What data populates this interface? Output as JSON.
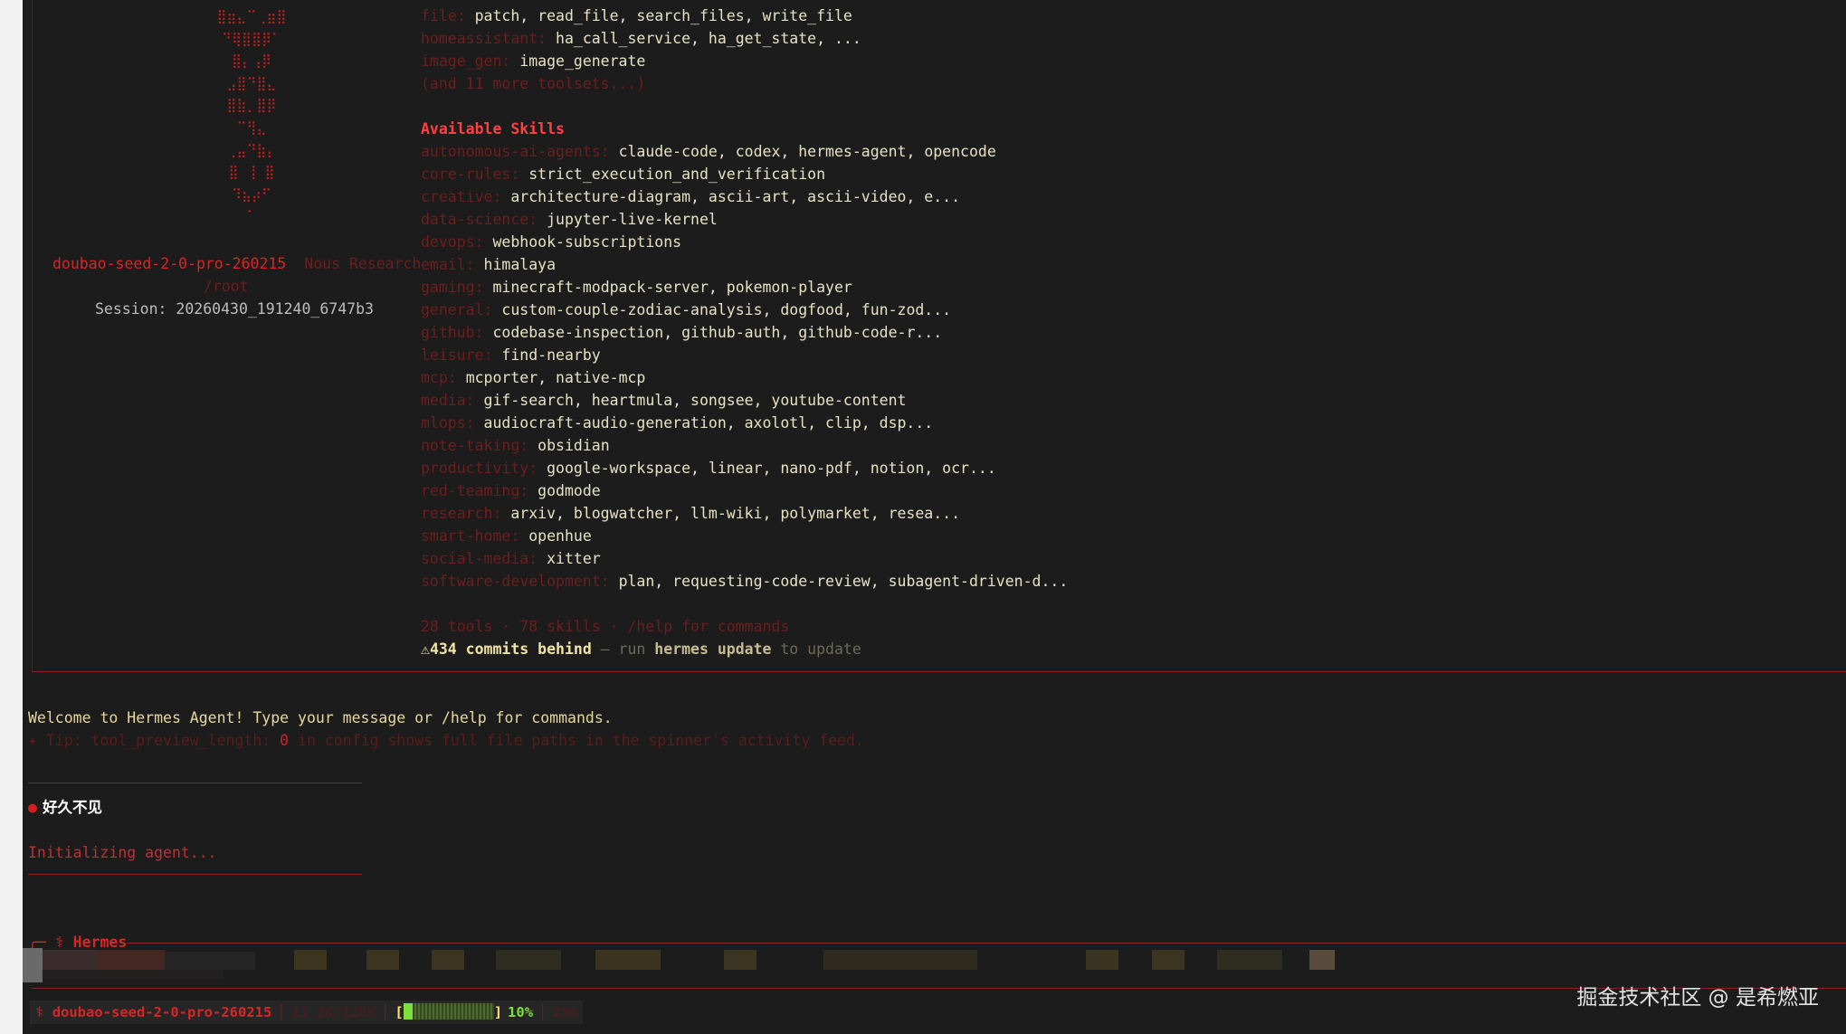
{
  "banner": {
    "art_lines": [
      "⣿⣶⣄⠉⢀⣶⣿",
      "⠙⢿⣿⣿⡿⠁",
      "⣿⡄⢠⡿",
      "⣠⣿⠙⣿⣄",
      "⣿⣷⡀⣿⡿",
      "⠉⢻⣄",
      "⢀⣤⠙⣷⡄",
      "⣿ ⢸ ⣿",
      "⠹⣦⡴⠋",
      "⠁"
    ],
    "model": "doubao-seed-2-0-pro-260215",
    "org": "Nous Research",
    "cwd": "/root",
    "session": "Session: 20260430_191240_6747b3"
  },
  "toolsets": [
    {
      "name": "file:",
      "items": "patch, read_file, search_files, write_file"
    },
    {
      "name": "homeassistant:",
      "items": "ha_call_service, ha_get_state, ..."
    },
    {
      "name": "image_gen:",
      "items": "image_generate"
    }
  ],
  "toolsets_more": "(and 11 more toolsets...)",
  "skills_heading": "Available Skills",
  "skills": [
    {
      "name": "autonomous-ai-agents:",
      "items": "claude-code, codex, hermes-agent, opencode"
    },
    {
      "name": "core-rules:",
      "items": "strict_execution_and_verification"
    },
    {
      "name": "creative:",
      "items": "architecture-diagram, ascii-art, ascii-video, e..."
    },
    {
      "name": "data-science:",
      "items": "jupyter-live-kernel"
    },
    {
      "name": "devops:",
      "items": "webhook-subscriptions"
    },
    {
      "name": "email:",
      "items": "himalaya"
    },
    {
      "name": "gaming:",
      "items": "minecraft-modpack-server, pokemon-player"
    },
    {
      "name": "general:",
      "items": "custom-couple-zodiac-analysis, dogfood, fun-zod..."
    },
    {
      "name": "github:",
      "items": "codebase-inspection, github-auth, github-code-r..."
    },
    {
      "name": "leisure:",
      "items": "find-nearby"
    },
    {
      "name": "mcp:",
      "items": "mcporter, native-mcp"
    },
    {
      "name": "media:",
      "items": "gif-search, heartmula, songsee, youtube-content"
    },
    {
      "name": "mlops:",
      "items": "audiocraft-audio-generation, axolotl, clip, dsp..."
    },
    {
      "name": "note-taking:",
      "items": "obsidian"
    },
    {
      "name": "productivity:",
      "items": "google-workspace, linear, nano-pdf, notion, ocr..."
    },
    {
      "name": "red-teaming:",
      "items": "godmode"
    },
    {
      "name": "research:",
      "items": "arxiv, blogwatcher, llm-wiki, polymarket, resea..."
    },
    {
      "name": "smart-home:",
      "items": "openhue"
    },
    {
      "name": "social-media:",
      "items": "xitter"
    },
    {
      "name": "software-development:",
      "items": "plan, requesting-code-review, subagent-driven-d..."
    }
  ],
  "summary": "28 tools · 78 skills · /help for commands",
  "update": {
    "icon": "⚠",
    "behind": "434 commits behind",
    "mid": " — run ",
    "cmd": "hermes update",
    "tail": " to update"
  },
  "welcome": "Welcome to Hermes Agent! Type your message or /help for commands.",
  "tip": {
    "prefix": "✦ Tip: tool_preview_length: ",
    "value": "0",
    "suffix": " in config shows full file paths in the spinner's activity feed."
  },
  "chat": {
    "bullet": "●",
    "user_message": "好久不见",
    "status": "Initializing agent..."
  },
  "agent_label": "╭─ ⚕ Hermes",
  "watermark": "掘金技术社区 @ 是希燃亚",
  "status_bar": {
    "icon": "⚕",
    "model": "doubao-seed-2-0-pro-260215",
    "sep": "│",
    "tokens": "11.1K/128K",
    "bracket_open": "[",
    "progress": 0.1,
    "bracket_close": "]",
    "percent": "10%",
    "elapsed": "28m"
  },
  "colors": {
    "background": "#1c1c1c",
    "accent_red": "#d92525",
    "dim_red": "#6b1f1f",
    "text_cream": "#e8e3c4",
    "warning_yellow": "#f2e4a4",
    "progress_green": "#7ee03b"
  }
}
